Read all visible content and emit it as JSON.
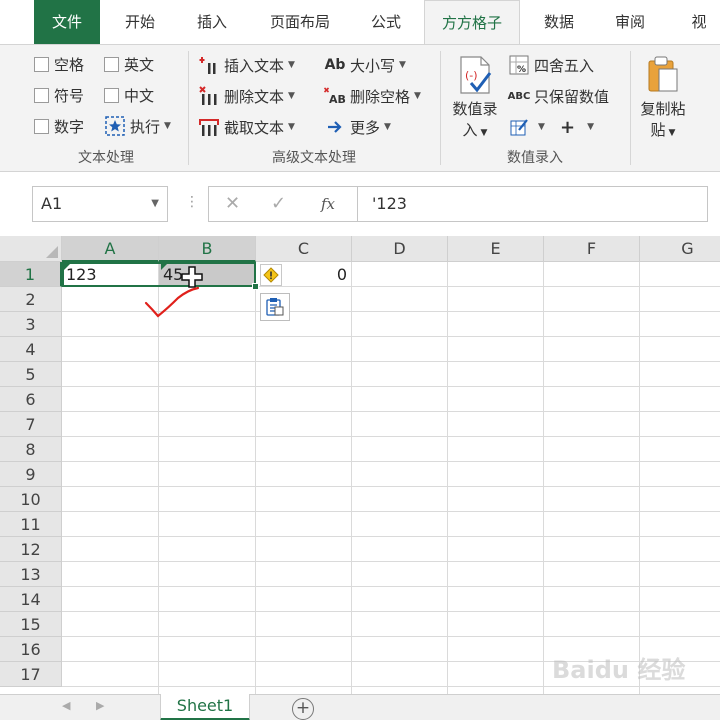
{
  "ribbon_tabs": [
    "文件",
    "开始",
    "插入",
    "页面布局",
    "公式",
    "方方格子",
    "数据",
    "审阅",
    "视"
  ],
  "groups": {
    "text_processing": {
      "label": "文本处理",
      "checkboxes": [
        "空格",
        "英文",
        "符号",
        "中文",
        "数字"
      ],
      "execute": "执行"
    },
    "advanced_text": {
      "label": "高级文本处理",
      "buttons": [
        "插入文本",
        "删除文本",
        "截取文本",
        "大小写",
        "删除空格",
        "更多"
      ],
      "icon_texts": [
        "Ab",
        "AB"
      ]
    },
    "numeric_entry": {
      "label": "数值录入",
      "big_button": [
        "数值录",
        "入"
      ],
      "buttons": [
        "四舍五入",
        "只保留数值"
      ],
      "icon_text": "ABC",
      "plus": "+"
    },
    "copy_paste": {
      "big_button": [
        "复制粘",
        "贴"
      ]
    }
  },
  "formula_bar": {
    "name_box": "A1",
    "formula": "'123"
  },
  "columns": [
    "A",
    "B",
    "C",
    "D",
    "E",
    "F",
    "G"
  ],
  "rows": [
    "1",
    "2",
    "3",
    "4",
    "5",
    "6",
    "7",
    "8",
    "9",
    "10",
    "11",
    "12",
    "13",
    "14",
    "15",
    "16",
    "17"
  ],
  "cells": {
    "A1": "123",
    "B1": "45",
    "C1": "0"
  },
  "sheets": [
    "Sheet1"
  ],
  "add_sheet": "+",
  "watermark": "Baidu 经验",
  "colors": {
    "accent": "#217346",
    "annotation": "#e0201b",
    "warning": "#e0a800"
  },
  "icons": {
    "warning": "warning-diamond-icon",
    "paste_options": "paste-options-icon",
    "cursor": "cross-cursor-icon",
    "annotation": "red-checkmark-annotation"
  }
}
